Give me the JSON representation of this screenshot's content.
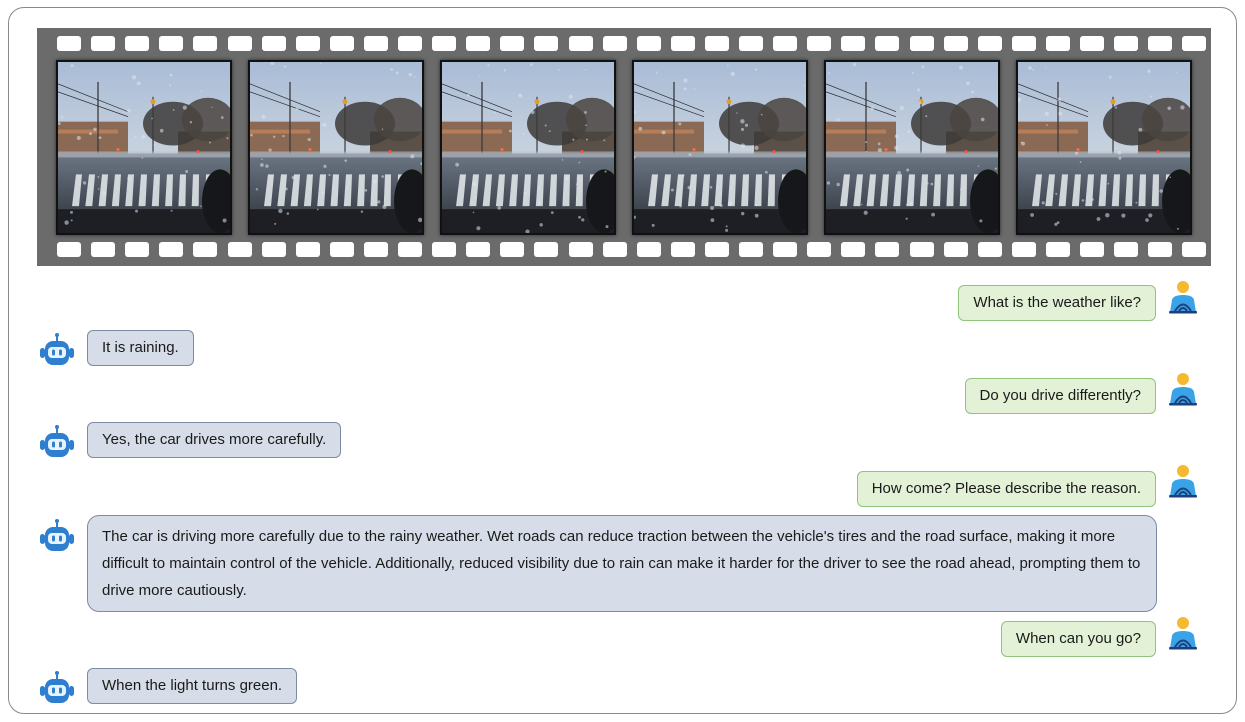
{
  "film": {
    "frame_count": 6,
    "frames": [
      {
        "name": "frame-1"
      },
      {
        "name": "frame-2"
      },
      {
        "name": "frame-3"
      },
      {
        "name": "frame-4"
      },
      {
        "name": "frame-5"
      },
      {
        "name": "frame-6"
      }
    ]
  },
  "conversation": [
    {
      "role": "user",
      "text": "What is the weather like?"
    },
    {
      "role": "assistant",
      "text": "It is raining."
    },
    {
      "role": "user",
      "text": "Do you drive differently?"
    },
    {
      "role": "assistant",
      "text": "Yes, the car drives more carefully."
    },
    {
      "role": "user",
      "text": "How come? Please describe the reason."
    },
    {
      "role": "assistant",
      "text": "The car is driving more carefully due to the rainy weather. Wet roads can reduce traction between the vehicle's tires and the road surface, making it more difficult to maintain control of the vehicle. Additionally, reduced visibility due to rain can make it harder for the driver to see the road ahead, prompting them to drive more cautiously."
    },
    {
      "role": "user",
      "text": "When can you go?"
    },
    {
      "role": "assistant",
      "text": "When the light turns green."
    }
  ],
  "colors": {
    "user_bubble": "#e3f1d7",
    "user_border": "#8fc47a",
    "bot_bubble": "#d7dde8",
    "bot_border": "#7f8aa3",
    "bot_icon": "#2e7fcf",
    "user_head": "#f5b82e",
    "user_body": "#3aa3e8"
  },
  "icons": {
    "user": "user-avatar-icon",
    "assistant": "robot-avatar-icon"
  }
}
